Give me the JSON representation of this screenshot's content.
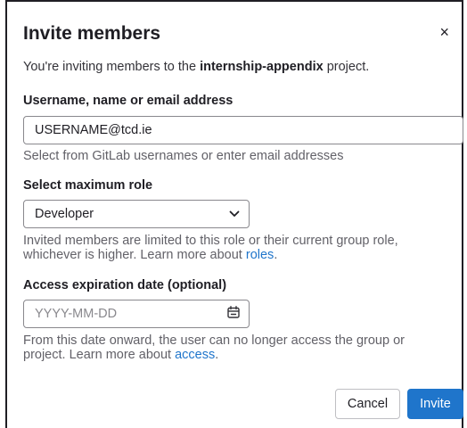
{
  "modal": {
    "title": "Invite members",
    "close_glyph": "×",
    "intro_prefix": "You're inviting members to the ",
    "intro_project": "internship-appendix",
    "intro_suffix": " project."
  },
  "username": {
    "label": "Username, name or email address",
    "value": "USERNAME@tcd.ie",
    "help": "Select from GitLab usernames or enter email addresses"
  },
  "role": {
    "label": "Select maximum role",
    "selected": "Developer",
    "help_text": "Invited members are limited to this role or their current group role, whichever is higher. Learn more about ",
    "help_link": "roles",
    "help_end": "."
  },
  "expiration": {
    "label": "Access expiration date (optional)",
    "placeholder": "YYYY-MM-DD",
    "help_text": "From this date onward, the user can no longer access the group or project. Learn more about ",
    "help_link": "access",
    "help_end": "."
  },
  "buttons": {
    "cancel": "Cancel",
    "invite": "Invite"
  },
  "icons": {
    "close": "close-icon",
    "chevron": "chevron-down-icon",
    "calendar": "calendar-icon"
  },
  "colors": {
    "primary": "#1f75cb",
    "link": "#1f75cb",
    "text": "#333238",
    "muted": "#626168"
  }
}
